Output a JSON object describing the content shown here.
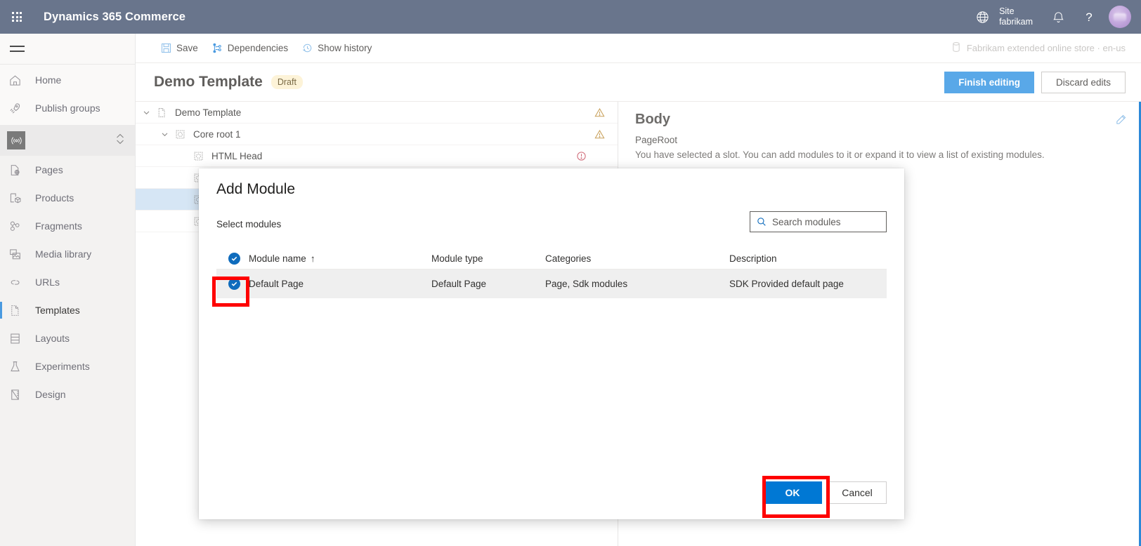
{
  "topbar": {
    "waffle_icon": "app-launcher-icon",
    "app_title": "Dynamics 365 Commerce",
    "globe_icon": "globe-icon",
    "site_label": "Site",
    "site_name": "fabrikam",
    "bell_icon": "notifications-bell-icon",
    "help_icon": "help-question-icon",
    "avatar_icon": "user-avatar",
    "background_color": "#69758c"
  },
  "sidebar": {
    "hamburger_icon": "hamburger-menu-icon",
    "items": [
      {
        "label": "Home",
        "icon": "home-icon",
        "active": false
      },
      {
        "label": "Publish groups",
        "icon": "rocket-icon",
        "active": false
      },
      {
        "label": "Pages",
        "icon": "page-globe-icon",
        "active": false
      },
      {
        "label": "Products",
        "icon": "product-box-icon",
        "active": false
      },
      {
        "label": "Fragments",
        "icon": "fragments-icon",
        "active": false
      },
      {
        "label": "Media library",
        "icon": "media-library-icon",
        "active": false
      },
      {
        "label": "URLs",
        "icon": "link-icon",
        "active": false
      },
      {
        "label": "Templates",
        "icon": "template-icon",
        "active": true
      },
      {
        "label": "Layouts",
        "icon": "layouts-icon",
        "active": false
      },
      {
        "label": "Experiments",
        "icon": "flask-icon",
        "active": false
      },
      {
        "label": "Design",
        "icon": "design-ruler-icon",
        "active": false
      }
    ],
    "channel_selector": {
      "icon": "channel-broadcast-icon",
      "expand_icon": "chevron-up-down-icon"
    },
    "active_accent_color": "#4a9ae0"
  },
  "commandbar": {
    "save_label": "Save",
    "save_icon": "save-disk-icon",
    "dependencies_label": "Dependencies",
    "dependencies_icon": "dependencies-icon",
    "show_history_label": "Show history",
    "show_history_icon": "history-clock-icon",
    "context_icon": "database-icon",
    "context_label": "Fabrikam extended online store · en-us"
  },
  "pageheader": {
    "title": "Demo Template",
    "status_badge": "Draft",
    "finish_editing_label": "Finish editing",
    "discard_edits_label": "Discard edits",
    "primary_color": "#59a8e8"
  },
  "tree": {
    "rows": [
      {
        "label": "Demo Template",
        "indent": 0,
        "chevron": "chevron-down-icon",
        "node_icon": "document-icon",
        "status": "warning",
        "selected": false
      },
      {
        "label": "Core root 1",
        "indent": 1,
        "chevron": "chevron-down-icon",
        "node_icon": "module-icon",
        "status": "warning",
        "selected": false
      },
      {
        "label": "HTML Head",
        "indent": 2,
        "chevron": "",
        "node_icon": "module-icon",
        "status": "error",
        "selected": false
      },
      {
        "label": "",
        "indent": 2,
        "chevron": "",
        "node_icon": "module-icon",
        "status": "",
        "selected": false
      },
      {
        "label": "",
        "indent": 2,
        "chevron": "",
        "node_icon": "module-icon",
        "status": "",
        "selected": true
      },
      {
        "label": "",
        "indent": 2,
        "chevron": "",
        "node_icon": "module-icon",
        "status": "",
        "selected": false
      }
    ]
  },
  "properties": {
    "title": "Body",
    "subtitle": "PageRoot",
    "description": "You have selected a slot. You can add modules to it or expand it to view a list of existing modules.",
    "edit_icon": "pencil-edit-icon"
  },
  "modal": {
    "title": "Add Module",
    "select_label": "Select modules",
    "search": {
      "icon": "search-icon",
      "placeholder": "Search modules",
      "value": ""
    },
    "columns": [
      "Module name",
      "Module type",
      "Categories",
      "Description"
    ],
    "sort_column": "Module name",
    "sort_indicator": "↑",
    "header_checkbox_checked": true,
    "rows": [
      {
        "checked": true,
        "module_name": "Default Page",
        "module_type": "Default Page",
        "categories": "Page, Sdk modules",
        "description": "SDK Provided default page"
      }
    ],
    "ok_label": "OK",
    "cancel_label": "Cancel",
    "ok_color": "#0078d4"
  },
  "annotations": {
    "color": "#fe0000",
    "boxes": [
      {
        "name": "row-checkbox-highlight"
      },
      {
        "name": "ok-button-highlight"
      }
    ]
  }
}
